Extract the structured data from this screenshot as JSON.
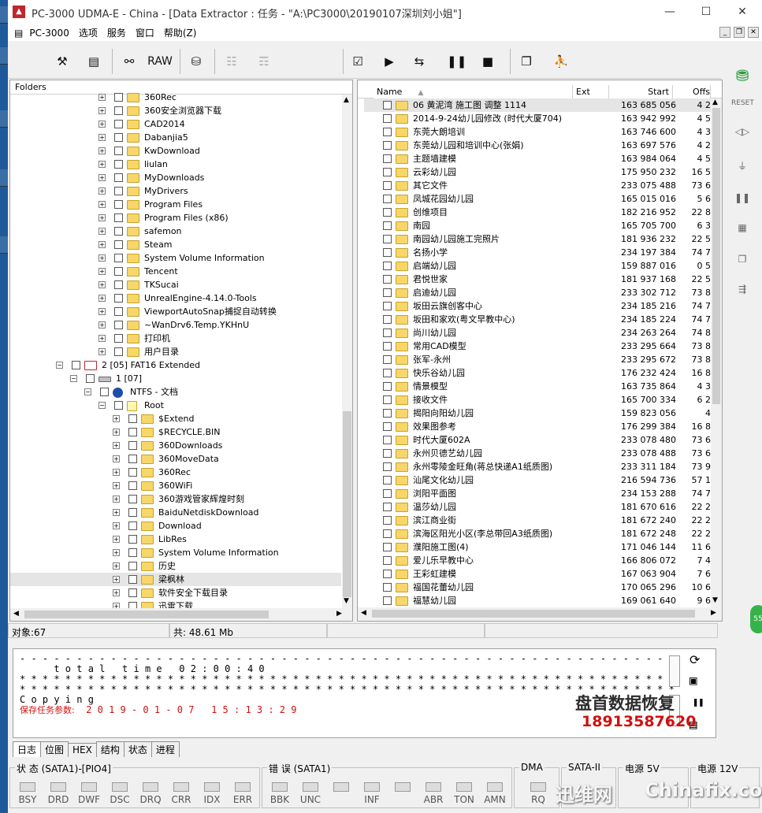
{
  "window": {
    "title": "PC-3000 UDMA-E - China - [Data Extractor : 任务 - \"A:\\PC3000\\20190107深圳刘小姐\"]",
    "min": "—",
    "max": "☐",
    "close": "✕"
  },
  "menu": [
    "PC-3000",
    "选项",
    "服务",
    "窗口",
    "帮助(Z)"
  ],
  "toolbar": {
    "raw_label": "RAW"
  },
  "left_pane": {
    "header": "Folders",
    "rows": [
      {
        "label": "360Rec",
        "level": 2,
        "icon": "folder"
      },
      {
        "label": "360安全浏览器下载",
        "level": 2,
        "icon": "folder"
      },
      {
        "label": "CAD2014",
        "level": 2,
        "icon": "folder"
      },
      {
        "label": "Dabanjia5",
        "level": 2,
        "icon": "folder"
      },
      {
        "label": "KwDownload",
        "level": 2,
        "icon": "folder"
      },
      {
        "label": "liulan",
        "level": 2,
        "icon": "folder"
      },
      {
        "label": "MyDownloads",
        "level": 2,
        "icon": "folder"
      },
      {
        "label": "MyDrivers",
        "level": 2,
        "icon": "folder"
      },
      {
        "label": "Program Files",
        "level": 2,
        "icon": "folder"
      },
      {
        "label": "Program Files (x86)",
        "level": 2,
        "icon": "folder"
      },
      {
        "label": "safemon",
        "level": 2,
        "icon": "folder"
      },
      {
        "label": "Steam",
        "level": 2,
        "icon": "folder"
      },
      {
        "label": "System Volume Information",
        "level": 2,
        "icon": "folder"
      },
      {
        "label": "Tencent",
        "level": 2,
        "icon": "folder"
      },
      {
        "label": "TKSucai",
        "level": 2,
        "icon": "folder"
      },
      {
        "label": "UnrealEngine-4.14.0-Tools",
        "level": 2,
        "icon": "folder"
      },
      {
        "label": "ViewportAutoSnap捕捉自动转换",
        "level": 2,
        "icon": "folder"
      },
      {
        "label": "~WanDrv6.Temp.YKHnU",
        "level": 2,
        "icon": "folder"
      },
      {
        "label": "打印机",
        "level": 2,
        "icon": "folder"
      },
      {
        "label": "用户目录",
        "level": 2,
        "icon": "folder"
      },
      {
        "label": "2 [05] FAT16 Extended",
        "level": -1,
        "icon": "drive-red",
        "expander": "−"
      },
      {
        "label": "1 [07]",
        "level": 0,
        "icon": "drive",
        "expander": "−"
      },
      {
        "label": "NTFS - 文档",
        "level": 1,
        "icon": "info",
        "expander": "−"
      },
      {
        "label": "Root",
        "level": 2,
        "icon": "root",
        "expander": "−"
      },
      {
        "label": "$Extend",
        "level": 3,
        "icon": "folder"
      },
      {
        "label": "$RECYCLE.BIN",
        "level": 3,
        "icon": "folder"
      },
      {
        "label": "360Downloads",
        "level": 3,
        "icon": "folder"
      },
      {
        "label": "360MoveData",
        "level": 3,
        "icon": "folder"
      },
      {
        "label": "360Rec",
        "level": 3,
        "icon": "folder"
      },
      {
        "label": "360WiFi",
        "level": 3,
        "icon": "folder"
      },
      {
        "label": "360游戏管家辉煌时刻",
        "level": 3,
        "icon": "folder"
      },
      {
        "label": "BaiduNetdiskDownload",
        "level": 3,
        "icon": "folder"
      },
      {
        "label": "Download",
        "level": 3,
        "icon": "folder"
      },
      {
        "label": "LibRes",
        "level": 3,
        "icon": "folder"
      },
      {
        "label": "System Volume Information",
        "level": 3,
        "icon": "folder"
      },
      {
        "label": "历史",
        "level": 3,
        "icon": "folder"
      },
      {
        "label": "梁枫林",
        "level": 3,
        "icon": "folder",
        "selected": true
      },
      {
        "label": "软件安全下载目录",
        "level": 3,
        "icon": "folder"
      },
      {
        "label": "迅雷下载",
        "level": 3,
        "icon": "folder"
      }
    ]
  },
  "right_pane": {
    "columns": {
      "name": "Name",
      "ext": "Ext",
      "start": "Start",
      "off": "Offs"
    },
    "rows": [
      {
        "name": "06 黄泥湾 施工图 调整 1114",
        "start": "163 685 056",
        "off": "4 2"
      },
      {
        "name": "2014-9-24幼儿园修改 (时代大厦704)",
        "start": "163 942 992",
        "off": "4 5"
      },
      {
        "name": "东莞大朗培训",
        "start": "163 746 600",
        "off": "4 3"
      },
      {
        "name": "东莞幼儿园和培训中心(张娟)",
        "start": "163 697 576",
        "off": "4 2"
      },
      {
        "name": "主题墙建模",
        "start": "163 984 064",
        "off": "4 5"
      },
      {
        "name": "云彩幼儿园",
        "start": "175 950 232",
        "off": "16 5"
      },
      {
        "name": "其它文件",
        "start": "233 075 488",
        "off": "73 6"
      },
      {
        "name": "凤城花园幼儿园",
        "start": "165 015 016",
        "off": "5 6"
      },
      {
        "name": "创维项目",
        "start": "182 216 952",
        "off": "22 8"
      },
      {
        "name": "南园",
        "start": "165 705 700",
        "off": "6 3"
      },
      {
        "name": "南园幼儿园施工完照片",
        "start": "181 936 232",
        "off": "22 5"
      },
      {
        "name": "名扬小学",
        "start": "234 197 384",
        "off": "74 7"
      },
      {
        "name": "启端幼儿园",
        "start": "159 887 016",
        "off": "0 5"
      },
      {
        "name": "君悦世家",
        "start": "181 937 168",
        "off": "22 5"
      },
      {
        "name": "启迪幼儿园",
        "start": "233 302 712",
        "off": "73 8"
      },
      {
        "name": "坂田云旗创客中心",
        "start": "234 185 216",
        "off": "74 7"
      },
      {
        "name": "坂田和家欢(粤文早教中心)",
        "start": "234 185 224",
        "off": "74 7"
      },
      {
        "name": "尚川幼儿园",
        "start": "234 263 264",
        "off": "74 8"
      },
      {
        "name": "常用CAD模型",
        "start": "233 295 664",
        "off": "73 8"
      },
      {
        "name": "张军-永州",
        "start": "233 295 672",
        "off": "73 8"
      },
      {
        "name": "快乐谷幼儿园",
        "start": "176 232 424",
        "off": "16 8"
      },
      {
        "name": "情景模型",
        "start": "163 735 864",
        "off": "4 3"
      },
      {
        "name": "接收文件",
        "start": "165 700 334",
        "off": "6 2"
      },
      {
        "name": "揭阳向阳幼儿园",
        "start": "159 823 056",
        "off": "4"
      },
      {
        "name": "效果图参考",
        "start": "176 299 384",
        "off": "16 8"
      },
      {
        "name": "时代大厦602A",
        "start": "233 078 480",
        "off": "73 6"
      },
      {
        "name": "永州贝德艺幼儿园",
        "start": "233 078 488",
        "off": "73 6"
      },
      {
        "name": "永州零陵金旺角(蒋总快递A1纸质图)",
        "start": "233 311 184",
        "off": "73 9"
      },
      {
        "name": "汕尾文化幼儿园",
        "start": "216 594 736",
        "off": "57 1"
      },
      {
        "name": "浏阳平面图",
        "start": "234 153 288",
        "off": "74 7"
      },
      {
        "name": "温莎幼儿园",
        "start": "181 670 616",
        "off": "22 2"
      },
      {
        "name": "滨江商业街",
        "start": "181 672 240",
        "off": "22 2"
      },
      {
        "name": "滨海区阳光小区(李总带回A3纸质图)",
        "start": "181 672 248",
        "off": "22 2"
      },
      {
        "name": "濮阳施工图(4)",
        "start": "171 046 144",
        "off": "11 6"
      },
      {
        "name": "爱儿乐早教中心",
        "start": "166 806 072",
        "off": "7 4"
      },
      {
        "name": "王彩虹建模",
        "start": "167 063 904",
        "off": "7 6"
      },
      {
        "name": "福国花蕾幼儿园",
        "start": "170 065 296",
        "off": "10 6"
      },
      {
        "name": "福慧幼儿园",
        "start": "169 061 640",
        "off": "9 6"
      }
    ]
  },
  "status": {
    "objects": "对象:67",
    "total": "共: 48.61 Mb"
  },
  "log": {
    "dashes": "- - - - - - - - - - - - - - - - - - - - - - - - - - - - - - - - - - - - - - - - - - - - - - - - - - - - - - - - - -",
    "time": "      t o t a l   t i m e   0 2 : 0 0 : 4 0",
    "stars1": "* * * * * * * * * * * * * * * * * * * * * * * * * * * * * * * * * * * * * * * * * * * * * * * * * * * * * * * * * *",
    "stars2": "* * * * * * * * * * * * * * * * * * * * * * * * * * * * * * * * * * * * * * * * * * * * * * * * * * * * * * * * * *",
    "copying": "C o p y i n g",
    "saved_label": "保存任务参数:",
    "saved_time": "  2 0 1 9 - 0 1 - 0 7   1 5 : 1 3 : 2 9"
  },
  "tabs": [
    "日志",
    "位图",
    "HEX",
    "结构",
    "状态",
    "进程"
  ],
  "bottom": {
    "status_group": "状 态 (SATA1)-[PIO4]",
    "status_leds": [
      "BSY",
      "DRD",
      "DWF",
      "DSC",
      "DRQ",
      "CRR",
      "IDX",
      "ERR"
    ],
    "error_group": "错 误 (SATA1)",
    "error_leds": [
      "BBK",
      "UNC",
      "",
      "INF",
      "",
      "ABR",
      "TON",
      "AMN"
    ],
    "dma": "DMA",
    "dma_led": "RQ",
    "sata": "SATA-II",
    "power5": "电源 5V",
    "power12": "电源 12V"
  },
  "watermark": {
    "line1": "盘首数据恢复",
    "line2": "18913587620",
    "brand1": "迅维网",
    "brand2": "Chinafix.com"
  },
  "colors": {
    "title_red": "#c0262d",
    "folder": "#f7d66a",
    "log_red": "#d01010",
    "selected_row": "#e5e5e5"
  }
}
